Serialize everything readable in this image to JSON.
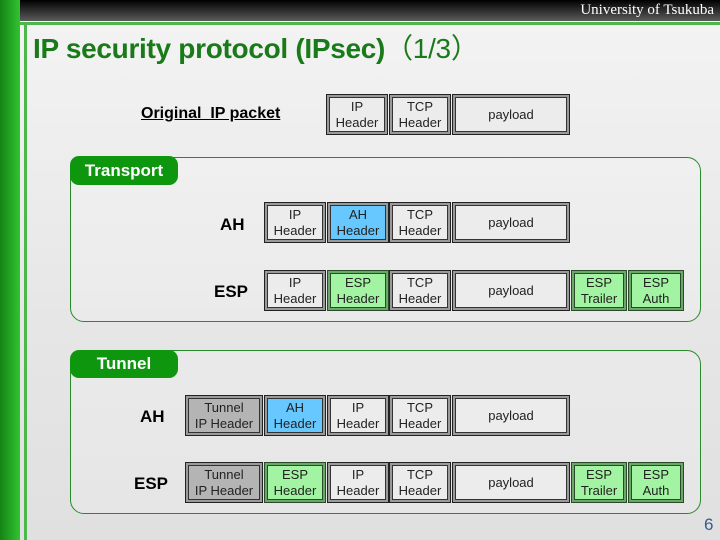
{
  "header": {
    "organization": "University of Tsukuba",
    "title": "IP security protocol (IPsec)",
    "title_suffix": "（1/3）"
  },
  "colors": {
    "title": "#1a7a1a",
    "accent_green": "#0e960e",
    "ah_header": "#66c8ff",
    "esp_block": "#a2f4a2",
    "tunnel_ip_header": "#b4b4b4",
    "default_block": "#ececec"
  },
  "original": {
    "label": "Original  IP packet",
    "blocks": [
      {
        "text": "IP\nHeader",
        "kind": "default"
      },
      {
        "text": "TCP\nHeader",
        "kind": "default"
      },
      {
        "text": "payload",
        "kind": "default"
      }
    ]
  },
  "transport": {
    "label": "Transport",
    "rows": [
      {
        "mode": "AH",
        "blocks": [
          {
            "text": "IP\nHeader",
            "kind": "default"
          },
          {
            "text": "AH\nHeader",
            "kind": "blue"
          },
          {
            "text": "TCP\nHeader",
            "kind": "default"
          },
          {
            "text": "payload",
            "kind": "default"
          }
        ]
      },
      {
        "mode": "ESP",
        "blocks": [
          {
            "text": "IP\nHeader",
            "kind": "default"
          },
          {
            "text": "ESP\nHeader",
            "kind": "green"
          },
          {
            "text": "TCP\nHeader",
            "kind": "default"
          },
          {
            "text": "payload",
            "kind": "default"
          },
          {
            "text": "ESP\nTrailer",
            "kind": "green"
          },
          {
            "text": "ESP\nAuth",
            "kind": "green"
          }
        ]
      }
    ]
  },
  "tunnel": {
    "label": "Tunnel",
    "rows": [
      {
        "mode": "AH",
        "blocks": [
          {
            "text": "Tunnel\nIP Header",
            "kind": "dark"
          },
          {
            "text": "AH\nHeader",
            "kind": "blue"
          },
          {
            "text": "IP\nHeader",
            "kind": "default"
          },
          {
            "text": "TCP\nHeader",
            "kind": "default"
          },
          {
            "text": "payload",
            "kind": "default"
          }
        ]
      },
      {
        "mode": "ESP",
        "blocks": [
          {
            "text": "Tunnel\nIP Header",
            "kind": "dark"
          },
          {
            "text": "ESP\nHeader",
            "kind": "green"
          },
          {
            "text": "IP\nHeader",
            "kind": "default"
          },
          {
            "text": "TCP\nHeader",
            "kind": "default"
          },
          {
            "text": "payload",
            "kind": "default"
          },
          {
            "text": "ESP\nTrailer",
            "kind": "green"
          },
          {
            "text": "ESP\nAuth",
            "kind": "green"
          }
        ]
      }
    ]
  },
  "footer": {
    "page_number": "6"
  }
}
